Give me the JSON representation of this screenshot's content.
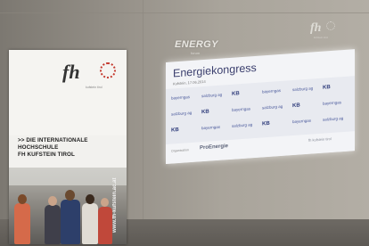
{
  "banner": {
    "logo_text": "fh",
    "logo_subtext": "kufstein tirol",
    "tagline_line1": ">> DIE INTERNATIONALE HOCHSCHULE",
    "tagline_line2": "FH KUFSTEIN TIROL",
    "vertical_url": "www.fh-kufstein.ac.at"
  },
  "wall": {
    "energy_logo": "ENERGY",
    "energy_sub": "forum",
    "fh_logo": "fh",
    "fh_sub": "kufstein tirol"
  },
  "screen": {
    "title": "Energiekongress",
    "date": "Kufstein, 17.06.2014",
    "sponsor_rows": [
      [
        "bayerngas",
        "salzburg ag",
        "KB",
        "bayerngas",
        "salzburg ag",
        "KB"
      ],
      [
        "salzburg ag",
        "KB",
        "bayerngas",
        "salzburg ag",
        "KB",
        "bayerngas"
      ],
      [
        "KB",
        "bayerngas",
        "salzburg ag",
        "KB",
        "bayerngas",
        "salzburg ag"
      ]
    ],
    "footer_label": "Organisation",
    "footer_logo": "ProEnergie",
    "footer_right": "fh kufstein tirol"
  }
}
